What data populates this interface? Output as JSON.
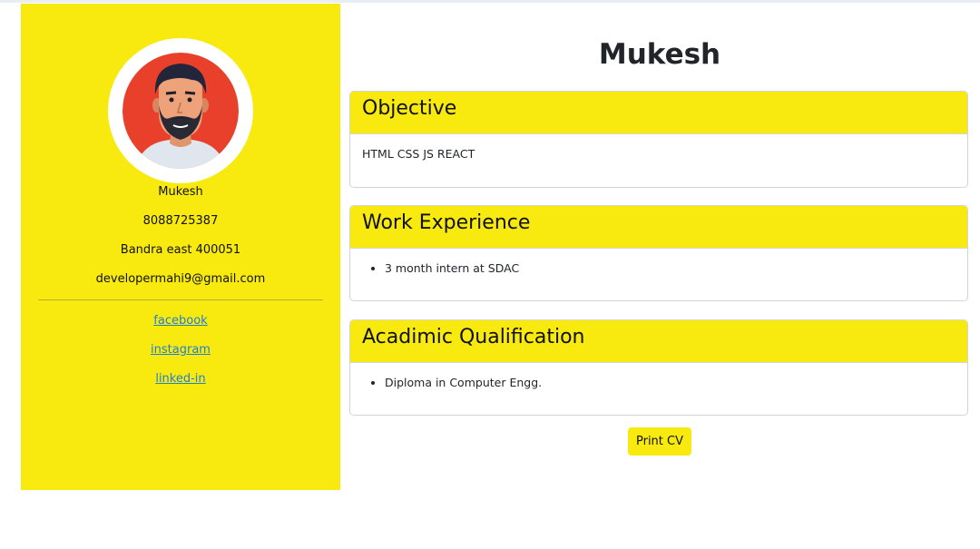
{
  "sidebar": {
    "avatar_icon": "man-with-beard-avatar-icon",
    "name": "Mukesh",
    "phone": "8088725387",
    "address": "Bandra east 400051",
    "email": "developermahi9@gmail.com",
    "links": {
      "facebook": "facebook",
      "instagram": "instagram",
      "linkedin": "linked-in"
    }
  },
  "main": {
    "title": "Mukesh",
    "sections": {
      "objective": {
        "heading": "Objective",
        "text": "HTML CSS JS REACT"
      },
      "experience": {
        "heading": "Work Experience",
        "items": [
          "3 month intern at SDAC"
        ]
      },
      "qualification": {
        "heading": "Acadimic Qualification",
        "items": [
          "Diploma in Computer Engg."
        ]
      }
    },
    "print_label": "Print CV"
  },
  "colors": {
    "accent": "#f8ea0f",
    "link": "#1f7fd6",
    "avatar_bg": "#e8402a"
  }
}
